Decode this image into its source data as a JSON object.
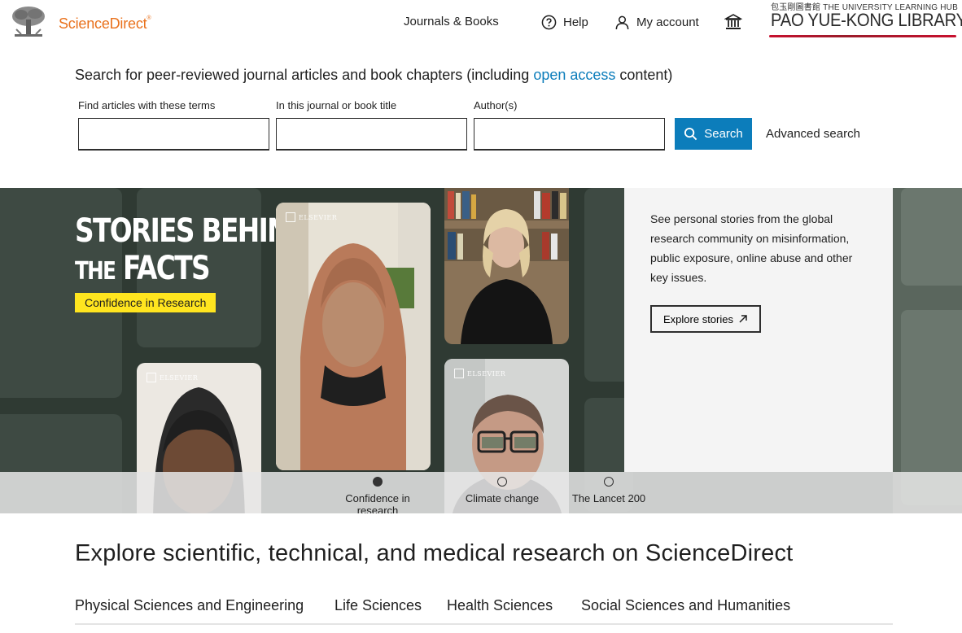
{
  "header": {
    "brand": "ScienceDirect",
    "brand_mark": "®",
    "nav": {
      "journals": "Journals & Books",
      "help": "Help",
      "account": "My account"
    },
    "library": {
      "top_line": "包玉剛圖書館  THE UNIVERSITY LEARNING HUB",
      "name": "PAO YUE-KONG LIBRARY"
    }
  },
  "search": {
    "heading_prefix": "Search for peer-reviewed journal articles and book chapters (including ",
    "heading_link": "open access",
    "heading_suffix": " content)",
    "fields": [
      {
        "label": "Find articles with these terms",
        "value": ""
      },
      {
        "label": "In this journal or book title",
        "value": ""
      },
      {
        "label": "Author(s)",
        "value": ""
      }
    ],
    "button": "Search",
    "advanced": "Advanced search"
  },
  "banner": {
    "title_line1": "STORIES BEHIND",
    "title_the": "THE",
    "title_line2": "FACTS",
    "tag": "Confidence in Research",
    "elsevier": "ELSEVIER",
    "description": "See personal stories from the global research community on misinformation, public exposure, online abuse and other key issues.",
    "cta": "Explore stories",
    "carousel": [
      {
        "label": "Confidence in research",
        "active": true
      },
      {
        "label": "Climate change",
        "active": false
      },
      {
        "label": "The Lancet 200",
        "active": false
      }
    ]
  },
  "explore": {
    "heading": "Explore scientific, technical, and medical research on ScienceDirect",
    "tabs": [
      "Physical Sciences and Engineering",
      "Life Sciences",
      "Health Sciences",
      "Social Sciences and Humanities"
    ]
  },
  "colors": {
    "brand_orange": "#e9711c",
    "link_blue": "#0c7dbb",
    "tag_yellow": "#ffe51f",
    "banner_dark": "#2f3a33"
  }
}
